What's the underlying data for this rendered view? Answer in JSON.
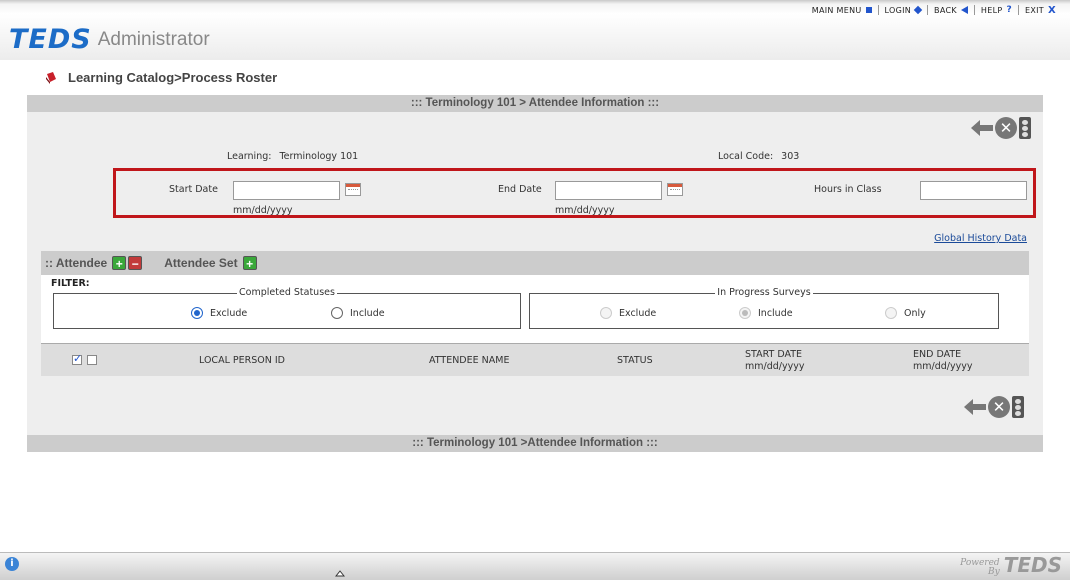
{
  "topnav": {
    "main_menu": "MAIN MENU",
    "login": "LOGIN",
    "back": "BACK",
    "help": "HELP",
    "exit": "EXIT"
  },
  "logo": {
    "brand": "TEDS",
    "app": "Administrator"
  },
  "breadcrumb": "Learning Catalog>Process Roster",
  "section": {
    "header": "::: Terminology 101 > Attendee Information :::",
    "footer": "::: Terminology 101 >Attendee Information :::",
    "learning_label": "Learning:",
    "learning_value": "Terminology 101",
    "local_code_label": "Local Code:",
    "local_code_value": "303",
    "fields": {
      "start_date_label": "Start Date",
      "start_date_value": "",
      "end_date_label": "End Date",
      "end_date_value": "",
      "hours_label": "Hours in Class",
      "hours_value": "",
      "date_hint": "mm/dd/yyyy"
    },
    "global_history": "Global History Data"
  },
  "attendee": {
    "tab_attendee": ":: Attendee",
    "tab_attendee_set": "Attendee Set",
    "filter_label": "FILTER:",
    "completed": {
      "legend": "Completed Statuses",
      "options": [
        "Exclude",
        "Include"
      ],
      "selected": "Exclude"
    },
    "in_progress": {
      "legend": "In Progress Surveys",
      "options": [
        "Exclude",
        "Include",
        "Only"
      ],
      "selected": "Include"
    },
    "columns": {
      "local_person_id": "LOCAL PERSON ID",
      "attendee_name": "ATTENDEE NAME",
      "status": "STATUS",
      "start_date": "START DATE",
      "start_date_fmt": "mm/dd/yyyy",
      "end_date": "END DATE",
      "end_date_fmt": "mm/dd/yyyy"
    }
  },
  "footer": {
    "powered": "Powered",
    "by": "By",
    "brand": "TEDS"
  },
  "colors": {
    "brand_blue": "#1c6cc7",
    "highlight_red": "#c0161a",
    "band_gray": "#cccccc"
  }
}
